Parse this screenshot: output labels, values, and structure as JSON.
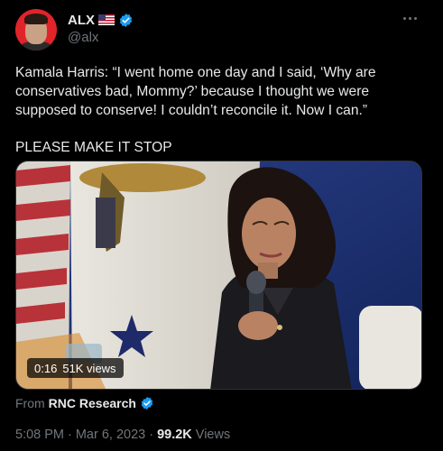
{
  "author": {
    "display_name": "ALX",
    "handle": "@alx",
    "flag_icon": "us-flag-icon",
    "verified_icon": "verified-badge-icon"
  },
  "tweet": {
    "text_line1": "Kamala Harris: “I went home one day and I said, ‘Why are conservatives bad, Mommy?’ because I thought we were supposed to conserve! I couldn’t reconcile it. Now I can.”",
    "text_line2": "PLEASE MAKE IT STOP"
  },
  "media": {
    "duration": "0:16",
    "views": "51K views"
  },
  "source": {
    "prefix": "From",
    "name": "RNC Research"
  },
  "meta": {
    "time": "5:08 PM",
    "separator1": "·",
    "date": "Mar 6, 2023",
    "separator2": "·",
    "views_count": "99.2K",
    "views_label": "Views"
  },
  "colors": {
    "background": "#000000",
    "text_primary": "#e7e9ea",
    "text_secondary": "#71767b",
    "verified": "#1d9bf0"
  }
}
